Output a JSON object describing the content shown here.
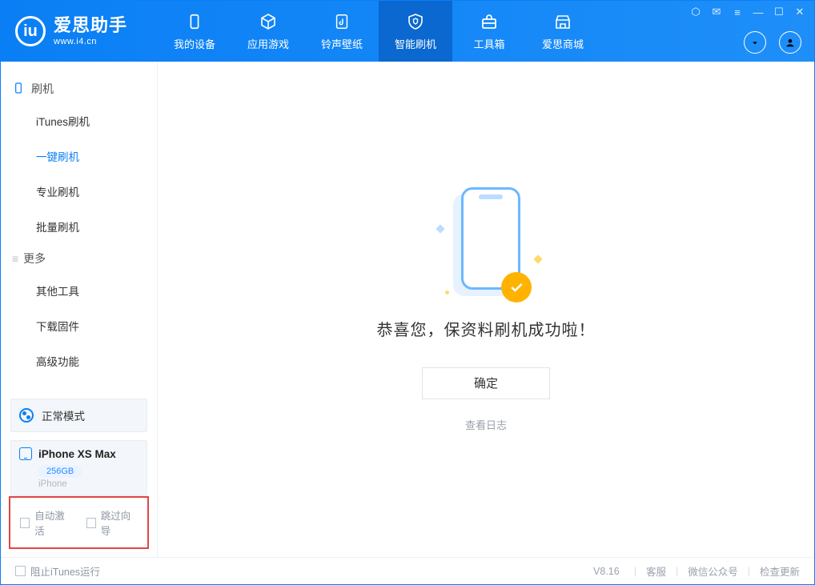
{
  "brand": {
    "name": "爱思助手",
    "url": "www.i4.cn"
  },
  "tabs": [
    {
      "label": "我的设备",
      "icon": "device"
    },
    {
      "label": "应用游戏",
      "icon": "cube"
    },
    {
      "label": "铃声壁纸",
      "icon": "music"
    },
    {
      "label": "智能刷机",
      "icon": "shield",
      "active": true
    },
    {
      "label": "工具箱",
      "icon": "toolbox"
    },
    {
      "label": "爱思商城",
      "icon": "store"
    }
  ],
  "sidebar": {
    "groups": [
      {
        "title": "刷机",
        "items": [
          {
            "label": "iTunes刷机"
          },
          {
            "label": "一键刷机",
            "active": true
          },
          {
            "label": "专业刷机"
          },
          {
            "label": "批量刷机"
          }
        ]
      },
      {
        "title": "更多",
        "items": [
          {
            "label": "其他工具"
          },
          {
            "label": "下载固件"
          },
          {
            "label": "高级功能"
          }
        ]
      }
    ],
    "status": "正常模式",
    "device": {
      "name": "iPhone XS Max",
      "storage": "256GB",
      "type": "iPhone"
    },
    "checkboxes": [
      {
        "label": "自动激活"
      },
      {
        "label": "跳过向导"
      }
    ]
  },
  "result": {
    "message": "恭喜您，保资料刷机成功啦！",
    "confirm": "确定",
    "view_log": "查看日志"
  },
  "footer": {
    "block_itunes": "阻止iTunes运行",
    "version": "V8.16",
    "links": [
      "客服",
      "微信公众号",
      "检查更新"
    ]
  }
}
